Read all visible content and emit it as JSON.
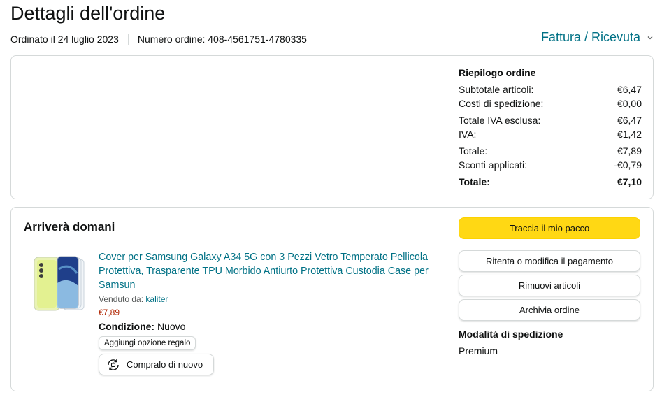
{
  "header": {
    "title": "Dettagli dell'ordine",
    "ordered_date": "Ordinato il 24 luglio 2023",
    "order_number": "Numero ordine: 408-4561751-4780335",
    "invoice_label": "Fattura / Ricevuta"
  },
  "summary": {
    "title": "Riepilogo ordine",
    "rows": [
      {
        "label": "Subtotale articoli:",
        "value": "€6,47"
      },
      {
        "label": "Costi di spedizione:",
        "value": "€0,00"
      },
      {
        "label": "Totale IVA esclusa:",
        "value": "€6,47"
      },
      {
        "label": "IVA:",
        "value": "€1,42"
      },
      {
        "label": "Totale:",
        "value": "€7,89"
      },
      {
        "label": "Sconti applicati:",
        "value": "-€0,79"
      }
    ],
    "grand_total_label": "Totale:",
    "grand_total_value": "€7,10"
  },
  "shipment": {
    "title": "Arriverà domani",
    "product": {
      "title": "Cover per Samsung Galaxy A34 5G con 3 Pezzi Vetro Temperato Pellicola Protettiva, Trasparente TPU Morbido Antiurto Protettiva Custodia Case per Samsun",
      "sold_by_label": "Venduto da:",
      "seller": "kaliter",
      "price": "€7,89",
      "condition_label": "Condizione:",
      "condition_value": "Nuovo",
      "gift_label": "Aggiungi opzione regalo",
      "rebuy_label": "Compralo di nuovo"
    },
    "actions": {
      "track": "Traccia il mio pacco",
      "retry_payment": "Ritenta o modifica il pagamento",
      "remove_items": "Rimuovi articoli",
      "archive": "Archivia ordine"
    },
    "shipping_mode_title": "Modalità di spedizione",
    "shipping_mode_value": "Premium"
  },
  "colors": {
    "link": "#007185",
    "price": "#b12704",
    "primary_button": "#ffd814",
    "border": "#d5d9d9"
  },
  "icons": [
    "chevron-down-icon",
    "rebuy-cart-icon"
  ]
}
